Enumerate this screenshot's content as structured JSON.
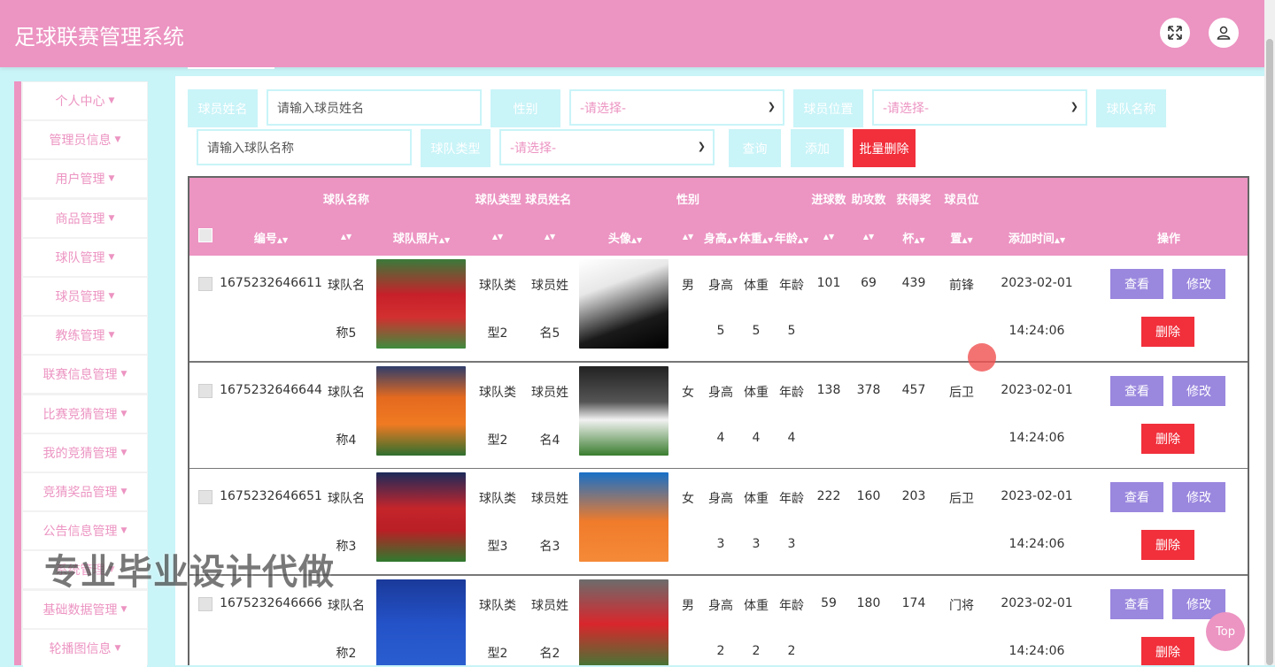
{
  "app": {
    "title": "足球联赛管理系统"
  },
  "header": {
    "expand_icon": "expand-icon",
    "user_icon": "user-icon"
  },
  "sidebar": {
    "items": [
      {
        "label": "个人中心"
      },
      {
        "label": "管理员信息"
      },
      {
        "label": "用户管理"
      },
      {
        "label": "商品管理"
      },
      {
        "label": "球队管理"
      },
      {
        "label": "球员管理"
      },
      {
        "label": "教练管理"
      },
      {
        "label": "联赛信息管理"
      },
      {
        "label": "比赛竞猜管理"
      },
      {
        "label": "我的竞猜管理"
      },
      {
        "label": "竞猜奖品管理"
      },
      {
        "label": "公告信息管理"
      },
      {
        "label": "系统管理"
      },
      {
        "label": "基础数据管理"
      },
      {
        "label": "轮播图信息"
      }
    ]
  },
  "filters": {
    "player_name_label": "球员姓名",
    "player_name_placeholder": "请输入球员姓名",
    "gender_label": "性别",
    "gender_value": "-请选择-",
    "position_label": "球员位置",
    "position_value": "-请选择-",
    "team_name_label": "球队名称",
    "team_name_placeholder": "请输入球队名称",
    "team_type_label": "球队类型",
    "team_type_value": "-请选择-",
    "search_label": "查询",
    "add_label": "添加",
    "batch_delete_label": "批量删除"
  },
  "table": {
    "headers_top": {
      "team_name": "球队名称",
      "team_type_player_name": "球队类型 球员姓名",
      "gender": "性别",
      "goals": "进球数",
      "assists": "助攻数",
      "awards": "获得奖",
      "position": "球员位"
    },
    "headers": {
      "id": "编号",
      "team_photo": "球队照片",
      "avatar": "头像",
      "height": "身高",
      "weight": "体重",
      "age": "年龄",
      "awards_tail": "杯",
      "position_tail": "置",
      "added": "添加时间",
      "actions": "操作"
    },
    "rows": [
      {
        "id": "1675232646611",
        "team_a": "球队名",
        "team_b": "称5",
        "type_a": "球队类",
        "type_b": "型2",
        "name_a": "球员姓",
        "name_b": "名5",
        "gender": "男",
        "h_a": "身高",
        "h_b": "5",
        "w_a": "体重",
        "w_b": "5",
        "age_a": "年龄",
        "age_b": "5",
        "goals": "101",
        "assists": "69",
        "awards": "439",
        "position": "前锋",
        "date": "2023-02-01",
        "time": "14:24:06"
      },
      {
        "id": "1675232646644",
        "team_a": "球队名",
        "team_b": "称4",
        "type_a": "球队类",
        "type_b": "型2",
        "name_a": "球员姓",
        "name_b": "名4",
        "gender": "女",
        "h_a": "身高",
        "h_b": "4",
        "w_a": "体重",
        "w_b": "4",
        "age_a": "年龄",
        "age_b": "4",
        "goals": "138",
        "assists": "378",
        "awards": "457",
        "position": "后卫",
        "date": "2023-02-01",
        "time": "14:24:06"
      },
      {
        "id": "1675232646651",
        "team_a": "球队名",
        "team_b": "称3",
        "type_a": "球队类",
        "type_b": "型3",
        "name_a": "球员姓",
        "name_b": "名3",
        "gender": "女",
        "h_a": "身高",
        "h_b": "3",
        "w_a": "体重",
        "w_b": "3",
        "age_a": "年龄",
        "age_b": "3",
        "goals": "222",
        "assists": "160",
        "awards": "203",
        "position": "后卫",
        "date": "2023-02-01",
        "time": "14:24:06"
      },
      {
        "id": "1675232646666",
        "team_a": "球队名",
        "team_b": "称2",
        "type_a": "球队类",
        "type_b": "型2",
        "name_a": "球员姓",
        "name_b": "名2",
        "gender": "男",
        "h_a": "身高",
        "h_b": "2",
        "w_a": "体重",
        "w_b": "2",
        "age_a": "年龄",
        "age_b": "2",
        "goals": "59",
        "assists": "180",
        "awards": "174",
        "position": "门将",
        "date": "2023-02-01",
        "time": "14:24:06"
      }
    ],
    "actions": {
      "view": "查看",
      "edit": "修改",
      "delete": "删除"
    }
  },
  "overlay": {
    "watermark": "专业毕业设计代做",
    "top_button": "Top"
  },
  "colors": {
    "primary_pink": "#ec94c2",
    "light_cyan": "#c9f4f8",
    "danger_red": "#f1303c",
    "action_purple": "#9a87de"
  }
}
